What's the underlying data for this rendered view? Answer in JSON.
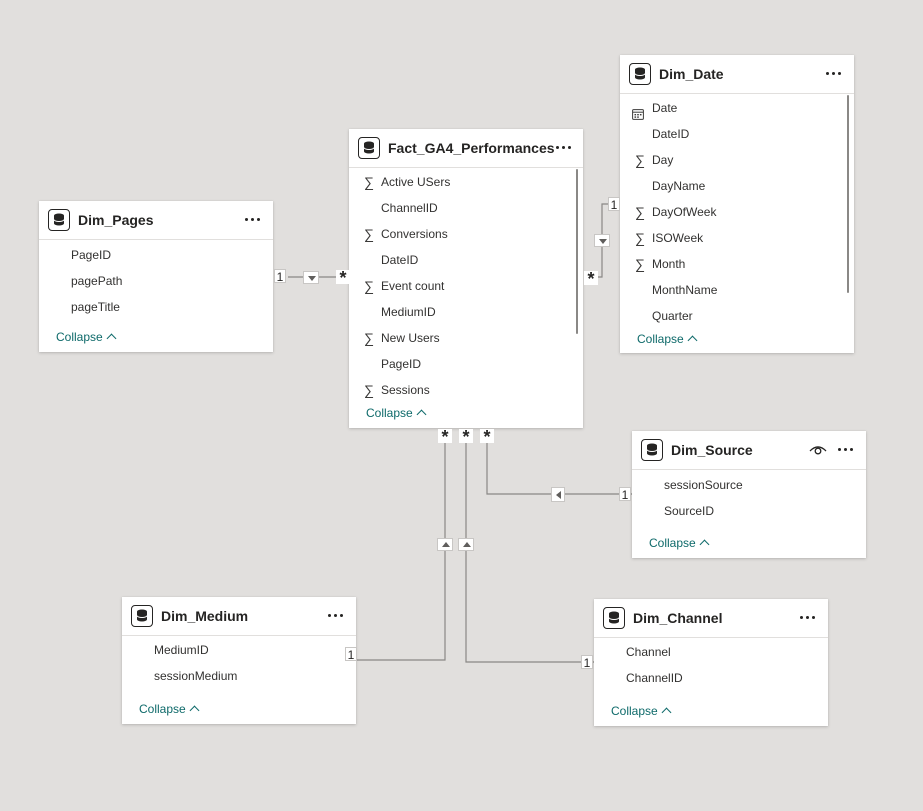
{
  "tables": {
    "fact": {
      "title": "Fact_GA4_Performances",
      "fields": [
        {
          "name": "Active USers",
          "icon": "sigma"
        },
        {
          "name": "ChannelID",
          "icon": ""
        },
        {
          "name": "Conversions",
          "icon": "sigma"
        },
        {
          "name": "DateID",
          "icon": ""
        },
        {
          "name": "Event count",
          "icon": "sigma"
        },
        {
          "name": "MediumID",
          "icon": ""
        },
        {
          "name": "New Users",
          "icon": "sigma"
        },
        {
          "name": "PageID",
          "icon": ""
        },
        {
          "name": "Sessions",
          "icon": "sigma"
        }
      ],
      "collapse_label": "Collapse"
    },
    "pages": {
      "title": "Dim_Pages",
      "fields": [
        {
          "name": "PageID",
          "icon": ""
        },
        {
          "name": "pagePath",
          "icon": ""
        },
        {
          "name": "pageTitle",
          "icon": ""
        }
      ],
      "collapse_label": "Collapse"
    },
    "date": {
      "title": "Dim_Date",
      "fields": [
        {
          "name": "Date",
          "icon": "calendar"
        },
        {
          "name": "DateID",
          "icon": ""
        },
        {
          "name": "Day",
          "icon": "sigma"
        },
        {
          "name": "DayName",
          "icon": ""
        },
        {
          "name": "DayOfWeek",
          "icon": "sigma"
        },
        {
          "name": "ISOWeek",
          "icon": "sigma"
        },
        {
          "name": "Month",
          "icon": "sigma"
        },
        {
          "name": "MonthName",
          "icon": ""
        },
        {
          "name": "Quarter",
          "icon": ""
        }
      ],
      "collapse_label": "Collapse"
    },
    "source": {
      "title": "Dim_Source",
      "fields": [
        {
          "name": "sessionSource",
          "icon": ""
        },
        {
          "name": "SourceID",
          "icon": ""
        }
      ],
      "collapse_label": "Collapse",
      "hidden_icon": "eye-icon"
    },
    "medium": {
      "title": "Dim_Medium",
      "fields": [
        {
          "name": "MediumID",
          "icon": ""
        },
        {
          "name": "sessionMedium",
          "icon": ""
        }
      ],
      "collapse_label": "Collapse"
    },
    "channel": {
      "title": "Dim_Channel",
      "fields": [
        {
          "name": "Channel",
          "icon": ""
        },
        {
          "name": "ChannelID",
          "icon": ""
        }
      ],
      "collapse_label": "Collapse"
    }
  },
  "relationships": [
    {
      "from": "pages",
      "to": "fact",
      "from_card": "1",
      "to_card": "*",
      "direction": "down"
    },
    {
      "from": "date",
      "to": "fact",
      "from_card": "1",
      "to_card": "*",
      "direction": "down"
    },
    {
      "from": "source",
      "to": "fact",
      "from_card": "1",
      "to_card": "*",
      "direction": "left"
    },
    {
      "from": "medium",
      "to": "fact",
      "from_card": "1",
      "to_card": "*",
      "direction": "up"
    },
    {
      "from": "channel",
      "to": "fact",
      "from_card": "1",
      "to_card": "*",
      "direction": "up"
    }
  ],
  "colors": {
    "canvas": "#e1dfdd",
    "card": "#ffffff",
    "line": "#8a8886",
    "link": "#0e6a6a"
  }
}
